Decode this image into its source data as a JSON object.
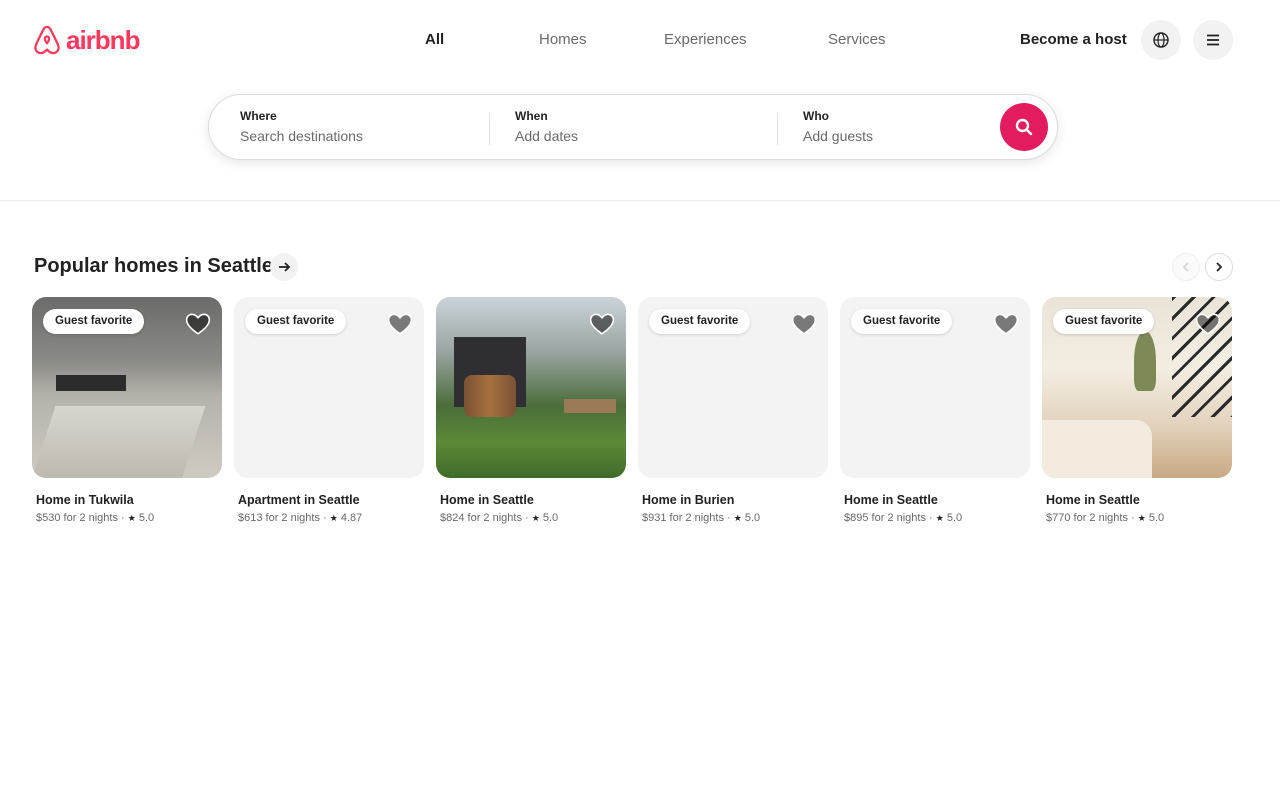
{
  "brand": {
    "name": "airbnb",
    "color": "#ff385c"
  },
  "nav": {
    "tabs": [
      {
        "label": "All",
        "active": true
      },
      {
        "label": "Homes",
        "active": false
      },
      {
        "label": "Experiences",
        "active": false
      },
      {
        "label": "Services",
        "active": false
      }
    ]
  },
  "header": {
    "host_label": "Become a host",
    "globe_icon": "globe-icon",
    "menu_icon": "menu-icon"
  },
  "search": {
    "where": {
      "label": "Where",
      "placeholder": "Search destinations"
    },
    "when": {
      "label": "When",
      "placeholder": "Add dates"
    },
    "who": {
      "label": "Who",
      "placeholder": "Add guests"
    },
    "button_color": "#e31c5f"
  },
  "section": {
    "title": "Popular homes in Seattle"
  },
  "listings": [
    {
      "badge": "Guest favorite",
      "title": "Home in Tukwila",
      "price": "$530 for 2 nights",
      "rating": "5.0"
    },
    {
      "badge": "Guest favorite",
      "title": "Apartment in Seattle",
      "price": "$613 for 2 nights",
      "rating": "4.87"
    },
    {
      "badge": "",
      "title": "Home in Seattle",
      "price": "$824 for 2 nights",
      "rating": "5.0"
    },
    {
      "badge": "Guest favorite",
      "title": "Home in Burien",
      "price": "$931 for 2 nights",
      "rating": "5.0"
    },
    {
      "badge": "Guest favorite",
      "title": "Home in Seattle",
      "price": "$895 for 2 nights",
      "rating": "5.0"
    },
    {
      "badge": "Guest favorite",
      "title": "Home in Seattle",
      "price": "$770 for 2 nights",
      "rating": "5.0"
    }
  ]
}
